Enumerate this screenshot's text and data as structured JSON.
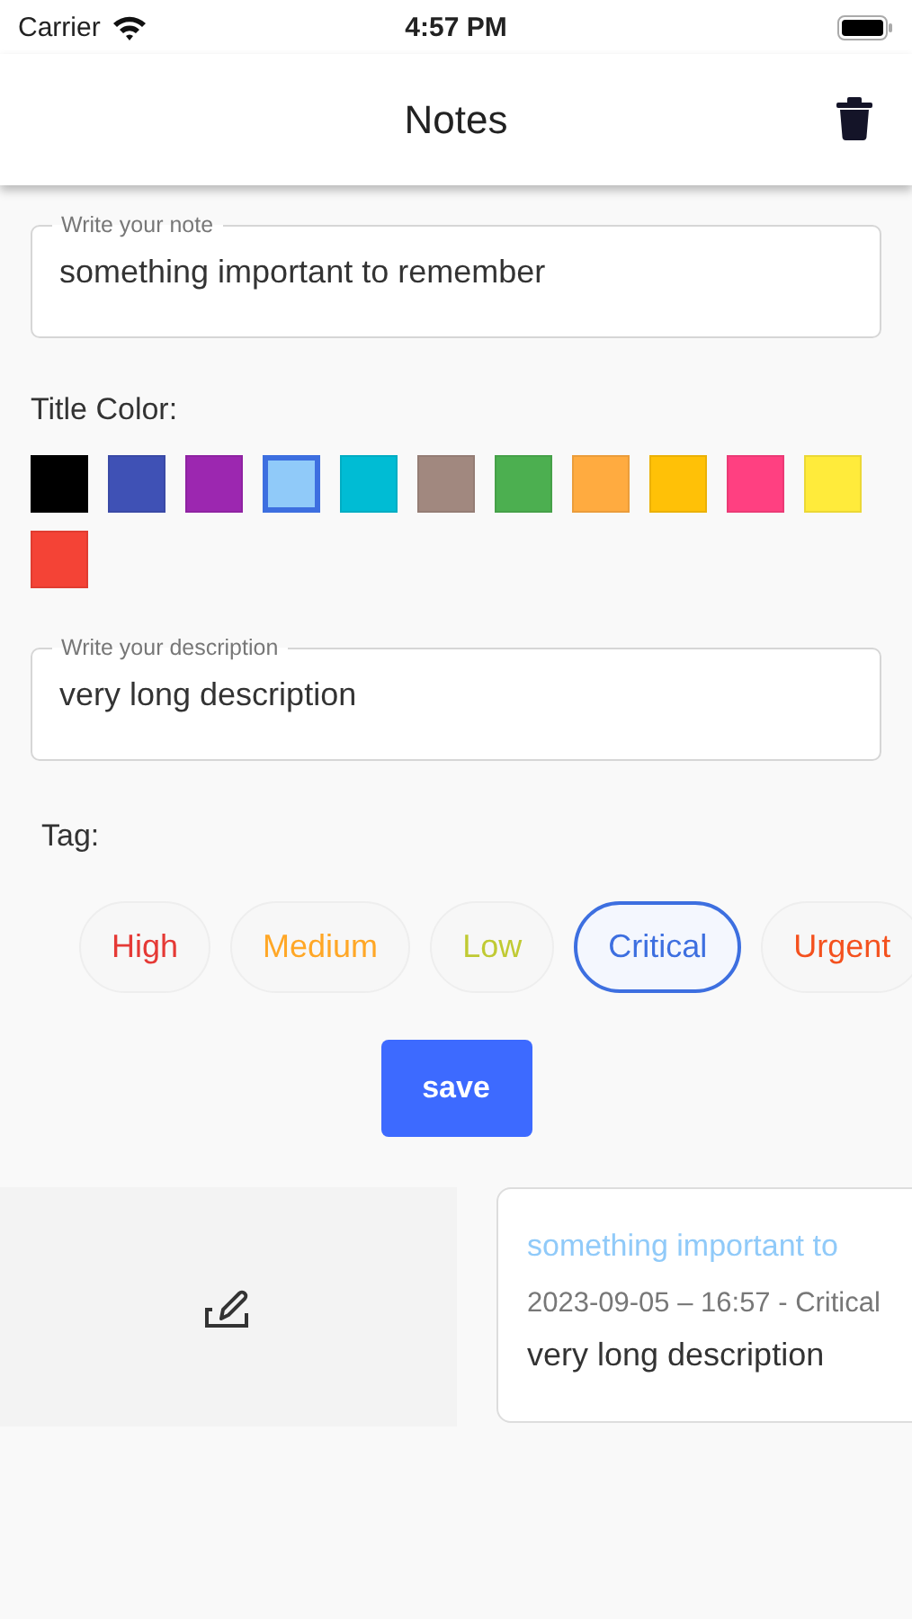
{
  "status_bar": {
    "carrier": "Carrier",
    "time": "4:57 PM"
  },
  "app_bar": {
    "title": "Notes"
  },
  "note_field": {
    "label": "Write your note",
    "value": "something important to remember"
  },
  "title_color": {
    "label": "Title Color:",
    "swatches": [
      {
        "color": "#000000",
        "selected": false
      },
      {
        "color": "#3f51b5",
        "selected": false
      },
      {
        "color": "#9c27b0",
        "selected": false
      },
      {
        "color": "#90caf9",
        "selected": true
      },
      {
        "color": "#00bcd4",
        "selected": false
      },
      {
        "color": "#a1887f",
        "selected": false
      },
      {
        "color": "#4caf50",
        "selected": false
      },
      {
        "color": "#ffab40",
        "selected": false
      },
      {
        "color": "#ffc107",
        "selected": false
      },
      {
        "color": "#ff4081",
        "selected": false
      },
      {
        "color": "#ffeb3b",
        "selected": false
      },
      {
        "color": "#f44336",
        "selected": false
      }
    ]
  },
  "description_field": {
    "label": "Write your description",
    "value": "very long description"
  },
  "tag": {
    "label": "Tag:",
    "chips": [
      {
        "label": "High",
        "color": "#e53935",
        "selected": false
      },
      {
        "label": "Medium",
        "color": "#ffa726",
        "selected": false
      },
      {
        "label": "Low",
        "color": "#c0ca33",
        "selected": false
      },
      {
        "label": "Critical",
        "color": "#3d6fe0",
        "selected": true
      },
      {
        "label": "Urgent",
        "color": "#f4511e",
        "selected": false
      }
    ]
  },
  "save_button": {
    "label": "save"
  },
  "notes": [
    {
      "title": "something important to",
      "meta": "2023-09-05 – 16:57 - Critical",
      "description": "very long description"
    }
  ]
}
